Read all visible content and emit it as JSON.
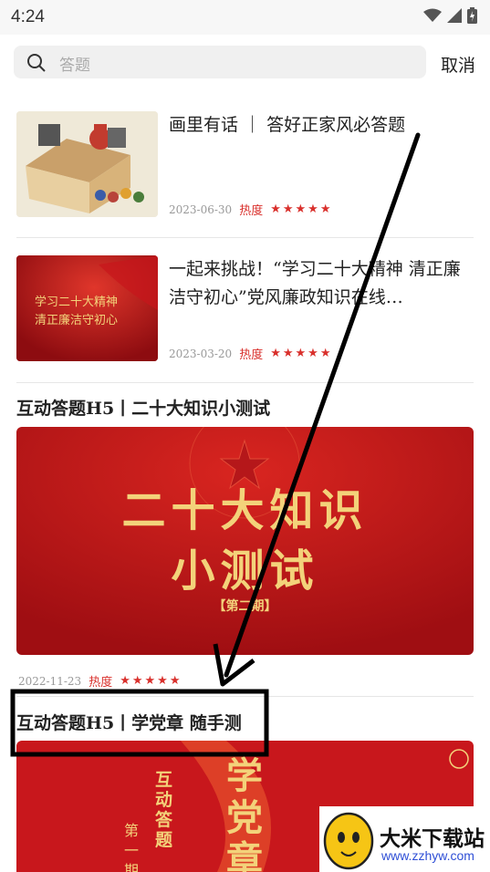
{
  "status": {
    "time": "4:24"
  },
  "search": {
    "placeholder": "答题",
    "cancel_label": "取消"
  },
  "cards": [
    {
      "title": "画里有话 ｜ 答好正家风必答题",
      "date": "2023-06-30",
      "heat_label": "热度",
      "rating": 5,
      "stars": "★★★★★"
    },
    {
      "title": "一起来挑战！“学习二十大精神 清正廉洁守初心”党风廉政知识在线…",
      "thumb_text_1": "学习二十大精神",
      "thumb_text_2": "清正廉洁守初心",
      "date": "2023-03-20",
      "heat_label": "热度",
      "rating": 5,
      "stars": "★★★★★"
    }
  ],
  "feature1": {
    "title": "互动答题H5丨二十大知识小测试",
    "banner_line1": "二十大知识",
    "banner_line2": "小测试",
    "banner_line3": "【第二期】",
    "date": "2022-11-23",
    "heat_label": "热度",
    "rating": 5,
    "stars": "★★★★★"
  },
  "feature2": {
    "title": "互动答题H5丨学党章 随手测",
    "banner_vertical": "互动答题",
    "banner_issue": "第一期",
    "banner_big": "学党章"
  },
  "watermark": {
    "name": "大米下载站",
    "url": "www.zzhyw.com"
  },
  "colors": {
    "accent_red": "#d9302c",
    "banner_red": "#c8171c",
    "gold": "#f3d27a"
  }
}
